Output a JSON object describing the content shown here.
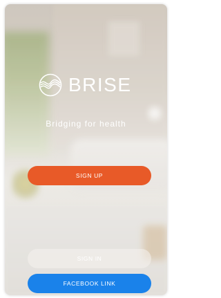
{
  "brand": {
    "name": "BRISE",
    "tagline": "Bridging for health",
    "logo_icon": "brise-wave-circle-logo"
  },
  "actions": {
    "sign_up_label": "SIGN UP",
    "sign_in_label": "SIGN IN",
    "facebook_label": "FACEBOOK LINK"
  },
  "colors": {
    "sign_up": "#e85a28",
    "facebook": "#1a82ea",
    "sign_in": "rgba(245,243,239,0.55)",
    "text": "#ffffff"
  }
}
